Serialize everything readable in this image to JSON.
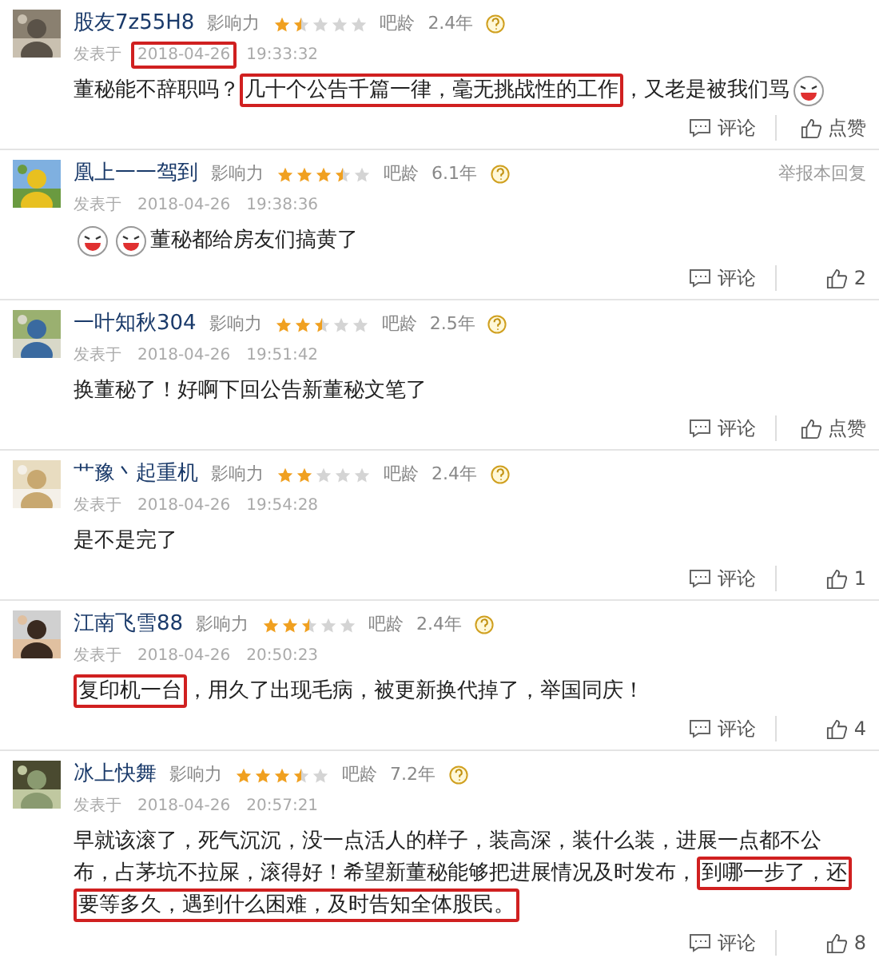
{
  "posts": [
    {
      "user": "股友7z55H8",
      "influence_label": "影响力",
      "stars": 1.5,
      "age_label": "吧龄",
      "age": "2.4年",
      "posted_label": "发表于",
      "date": "2018-04-26",
      "date_boxed": true,
      "time": "19:33:32",
      "content": [
        {
          "kind": "text",
          "text": "董秘能不辞职吗？",
          "boxed": false
        },
        {
          "kind": "text",
          "text": "几十个公告千篇一律，毫无挑战性的工作",
          "boxed": true
        },
        {
          "kind": "text",
          "text": "，又老是被我们骂",
          "boxed": false
        },
        {
          "kind": "emoji"
        }
      ],
      "comment_label": "评论",
      "like_label": "点赞"
    },
    {
      "user": "凰上一一驾到",
      "influence_label": "影响力",
      "stars": 3.5,
      "age_label": "吧龄",
      "age": "6.1年",
      "report": "举报本回复",
      "posted_label": "发表于",
      "date": "2018-04-26",
      "date_boxed": false,
      "time": "19:38:36",
      "content": [
        {
          "kind": "emoji"
        },
        {
          "kind": "emoji"
        },
        {
          "kind": "text",
          "text": "董秘都给房友们搞黄了",
          "boxed": false
        }
      ],
      "comment_label": "评论",
      "like_label": "2"
    },
    {
      "user": "一叶知秋304",
      "influence_label": "影响力",
      "stars": 2.5,
      "age_label": "吧龄",
      "age": "2.5年",
      "posted_label": "发表于",
      "date": "2018-04-26",
      "date_boxed": false,
      "time": "19:51:42",
      "content": [
        {
          "kind": "text",
          "text": "换董秘了！好啊下回公告新董秘文笔了",
          "boxed": false
        }
      ],
      "comment_label": "评论",
      "like_label": "点赞"
    },
    {
      "user": "艹豫丶起重机",
      "influence_label": "影响力",
      "stars": 2,
      "age_label": "吧龄",
      "age": "2.4年",
      "posted_label": "发表于",
      "date": "2018-04-26",
      "date_boxed": false,
      "time": "19:54:28",
      "content": [
        {
          "kind": "text",
          "text": "是不是完了",
          "boxed": false
        }
      ],
      "comment_label": "评论",
      "like_label": "1"
    },
    {
      "user": "江南飞雪88",
      "influence_label": "影响力",
      "stars": 2.5,
      "age_label": "吧龄",
      "age": "2.4年",
      "posted_label": "发表于",
      "date": "2018-04-26",
      "date_boxed": false,
      "time": "20:50:23",
      "content": [
        {
          "kind": "text",
          "text": "复印机一台",
          "boxed": true
        },
        {
          "kind": "text",
          "text": "，用久了出现毛病，被更新换代掉了，举国同庆！",
          "boxed": false
        }
      ],
      "comment_label": "评论",
      "like_label": "4"
    },
    {
      "user": "冰上快舞",
      "influence_label": "影响力",
      "stars": 3.5,
      "age_label": "吧龄",
      "age": "7.2年",
      "posted_label": "发表于",
      "date": "2018-04-26",
      "date_boxed": false,
      "time": "20:57:21",
      "content": [
        {
          "kind": "text",
          "text": "早就该滚了，死气沉沉，没一点活人的样子，装高深，装什么装，进展一点都不公布，占茅坑不拉屎，滚得好！希望新董秘能够把进展情况及时发布，",
          "boxed": false
        },
        {
          "kind": "text",
          "text": "到哪一步了，还要等多久，遇到什么困难，及时告知全体股民。",
          "boxed": true
        }
      ],
      "comment_label": "评论",
      "like_label": "8"
    }
  ]
}
